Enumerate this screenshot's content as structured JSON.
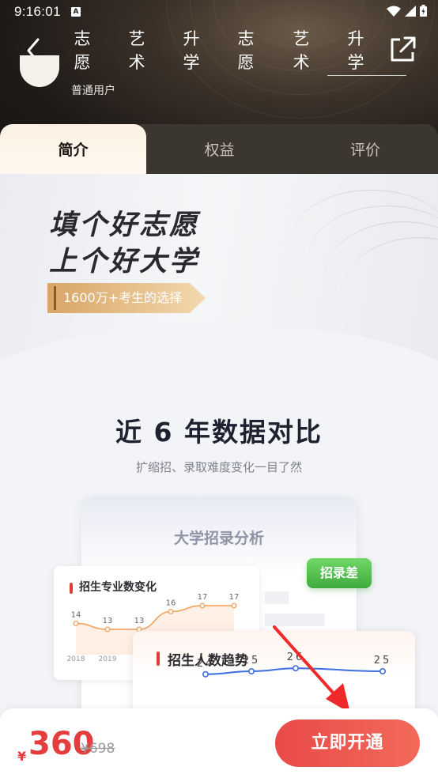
{
  "status_bar": {
    "time": "9:16:01",
    "notification_icon": "A"
  },
  "header": {
    "nav_columns": [
      {
        "c1": "志",
        "c2": "愿"
      },
      {
        "c1": "艺",
        "c2": "术"
      },
      {
        "c1": "升",
        "c2": "学"
      },
      {
        "c1": "志",
        "c2": "愿"
      },
      {
        "c1": "艺",
        "c2": "术"
      },
      {
        "c1": "升",
        "c2": "学"
      }
    ],
    "user_type": "普通用户"
  },
  "tabs": [
    {
      "label": "简介",
      "active": true
    },
    {
      "label": "权益",
      "active": false
    },
    {
      "label": "评价",
      "active": false
    }
  ],
  "banner": {
    "headline_1": "填个好志愿",
    "headline_2": "上个好大学",
    "tag": "1600万+考生的选择"
  },
  "section": {
    "title": "近 6 年数据对比",
    "subtitle": "扩缩招、录取难度变化一目了然",
    "card_title": "大学招录分析",
    "badge": "招录差"
  },
  "chart_data": [
    {
      "type": "line",
      "title": "招生专业数变化",
      "x": [
        "2018",
        "2019",
        "",
        "",
        "",
        ""
      ],
      "series": [
        {
          "values": [
            14,
            13,
            13,
            16,
            17,
            17
          ]
        }
      ],
      "color": "#f2a96b"
    },
    {
      "type": "line",
      "title": "招生人数趋势",
      "series": [
        {
          "values": [
            24,
            25,
            26,
            25
          ]
        }
      ],
      "color": "#3d6fe0"
    }
  ],
  "bottom": {
    "currency": "¥",
    "price": "360",
    "original_price": "¥698",
    "buy_label": "立即开通"
  }
}
